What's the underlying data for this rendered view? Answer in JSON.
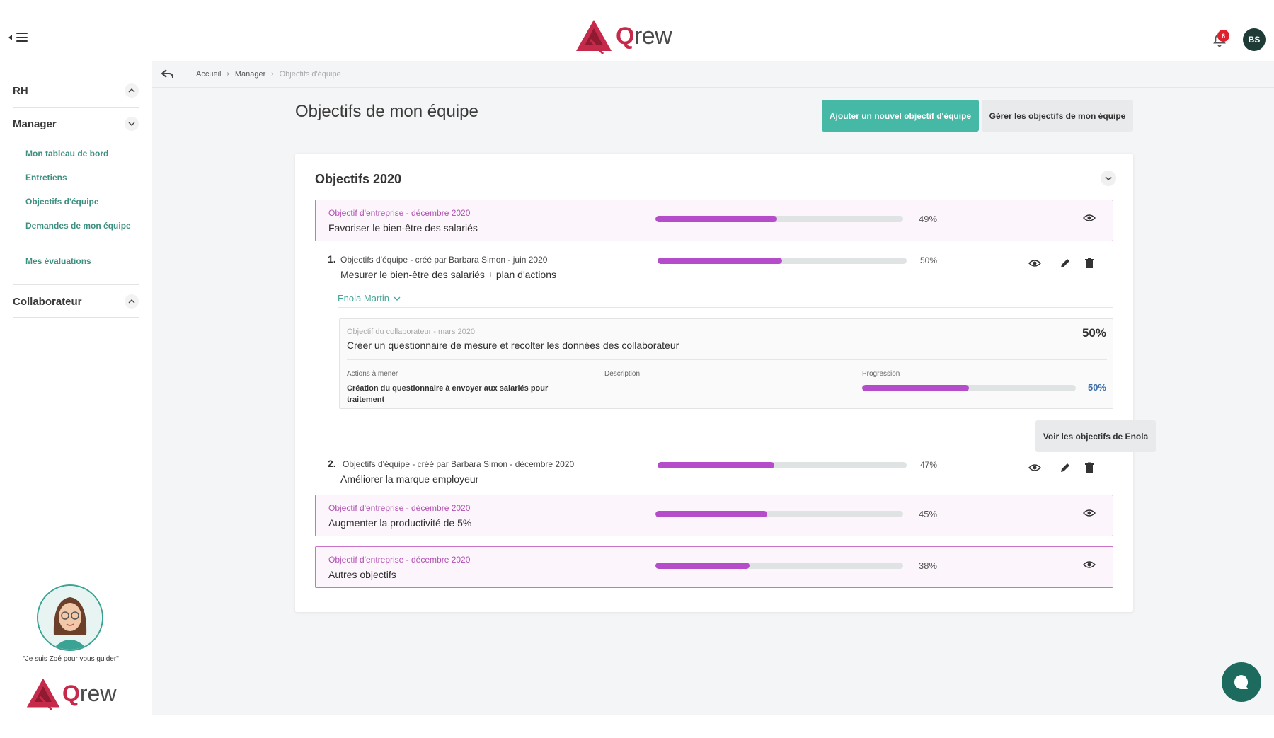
{
  "header": {
    "brand_q": "Q",
    "brand_rest": "rew",
    "notification_count": "6",
    "user_initials": "BS"
  },
  "sidebar": {
    "sections": [
      {
        "title": "RH",
        "expanded": false
      },
      {
        "title": "Manager",
        "expanded": true
      },
      {
        "title": "Collaborateur",
        "expanded": false
      }
    ],
    "manager_items": [
      {
        "label": "Mon tableau de bord"
      },
      {
        "label": "Entretiens"
      },
      {
        "label": "Objectifs d'équipe"
      },
      {
        "label": "Demandes de mon équipe"
      },
      {
        "label": "Mes évaluations"
      }
    ],
    "guide_caption": "\"Je suis Zoé pour vous guider\"",
    "brand_q": "Q",
    "brand_rest": "rew"
  },
  "breadcrumb": {
    "items": [
      "Accueil",
      "Manager",
      "Objectifs d'équipe"
    ]
  },
  "page": {
    "title": "Objectifs de mon équipe",
    "add_button": "Ajouter un nouvel objectif d'équipe",
    "manage_button": "Gérer les objectifs de mon équipe"
  },
  "card": {
    "title": "Objectifs 2020",
    "company_objectives": [
      {
        "label": "Objectif d'entreprise - décembre 2020",
        "name": "Favoriser le bien-être des salariés",
        "progress": 49,
        "pct_text": "49%"
      },
      {
        "label": "Objectif d'entreprise - décembre 2020",
        "name": "Augmenter la productivité de 5%",
        "progress": 45,
        "pct_text": "45%"
      },
      {
        "label": "Objectif d'entreprise - décembre 2020",
        "name": "Autres objectifs",
        "progress": 38,
        "pct_text": "38%"
      }
    ],
    "team_objectives": [
      {
        "num": "1.",
        "meta": "Objectifs d'équipe - créé par Barbara Simon - juin 2020",
        "name": "Mesurer le bien-être des salariés + plan d'actions",
        "progress": 50,
        "pct_text": "50%"
      },
      {
        "num": "2.",
        "meta": "Objectifs d'équipe - créé par Barbara Simon - décembre 2020",
        "name": "Améliorer la marque employeur",
        "progress": 47,
        "pct_text": "47%"
      }
    ],
    "member": {
      "name": "Enola Martin",
      "objective_meta": "Objectif du collaborateur - mars 2020",
      "objective_name": "Créer un questionnaire de mesure et recolter les données des collaborateur",
      "objective_pct": "50%",
      "col_actions": "Actions à mener",
      "col_description": "Description",
      "col_progression": "Progression",
      "action_text": "Création du questionnaire à envoyer aux salariés pour traitement",
      "action_progress": 50,
      "action_pct": "50%",
      "view_button": "Voir les objectifs de Enola"
    }
  },
  "colors": {
    "accent": "#46b8a6",
    "brand_red": "#c62a4a",
    "progress_fill": "#b54cc9",
    "company_border": "#c873c8",
    "chat": "#1c6b5e"
  }
}
